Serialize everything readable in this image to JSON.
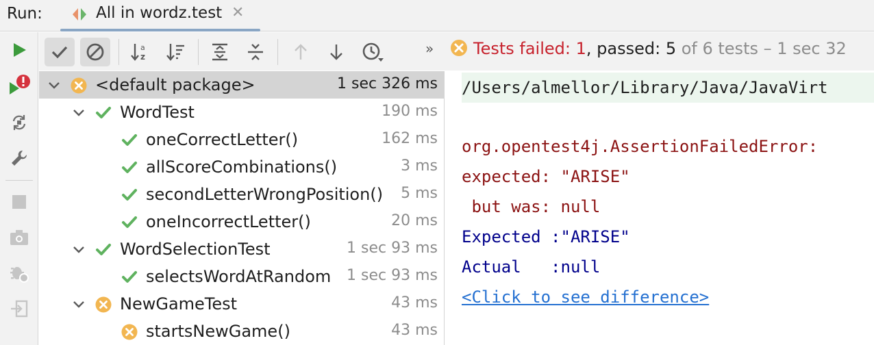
{
  "header": {
    "run_label": "Run:",
    "tab": {
      "title": "All in wordz.test",
      "close": "✕",
      "icon": "test-run-icon"
    }
  },
  "left_toolbar": [
    {
      "name": "rerun-icon"
    },
    {
      "name": "rerun-failed-icon"
    },
    {
      "name": "toggle-auto-test-icon"
    },
    {
      "name": "wrench-icon"
    },
    {
      "name": "stop-icon"
    },
    {
      "name": "camera-icon"
    },
    {
      "name": "debug-settings-icon"
    },
    {
      "name": "export-icon"
    }
  ],
  "toolbar": {
    "buttons": [
      "show-passed-icon",
      "show-ignored-icon",
      "sort-alphabetically-icon",
      "sort-by-duration-icon",
      "expand-all-icon",
      "collapse-all-icon",
      "previous-failed-icon",
      "next-failed-icon",
      "test-history-icon"
    ],
    "more": "»",
    "status": {
      "failed_label": "Tests failed: ",
      "failed_count": "1",
      "passed_part": ", passed: 5",
      "rest": " of 6 tests – 1 sec 32"
    }
  },
  "tree": {
    "rows": [
      {
        "label": "<default package>",
        "time": "1 sec 326 ms",
        "status": "failed",
        "level": 0,
        "expandable": true,
        "selected": true
      },
      {
        "label": "WordTest",
        "time": "190 ms",
        "status": "passed",
        "level": 1,
        "expandable": true
      },
      {
        "label": "oneCorrectLetter()",
        "time": "162 ms",
        "status": "passed",
        "level": 2
      },
      {
        "label": "allScoreCombinations()",
        "time": "3 ms",
        "status": "passed",
        "level": 2
      },
      {
        "label": "secondLetterWrongPosition()",
        "time": "5 ms",
        "status": "passed",
        "level": 2
      },
      {
        "label": "oneIncorrectLetter()",
        "time": "20 ms",
        "status": "passed",
        "level": 2
      },
      {
        "label": "WordSelectionTest",
        "time": "1 sec 93 ms",
        "status": "passed",
        "level": 1,
        "expandable": true
      },
      {
        "label": "selectsWordAtRandom",
        "time": "1 sec 93 ms",
        "status": "passed",
        "level": 2
      },
      {
        "label": "NewGameTest",
        "time": "43 ms",
        "status": "failed",
        "level": 1,
        "expandable": true
      },
      {
        "label": "startsNewGame()",
        "time": "43 ms",
        "status": "failed",
        "level": 2
      }
    ]
  },
  "console": {
    "command": "/Users/almellor/Library/Java/JavaVirt",
    "lines": [
      "org.opentest4j.AssertionFailedError:",
      "expected: \"ARISE\"",
      " but was: null",
      "Expected :\"ARISE\"",
      "Actual   :null"
    ],
    "diff_link": "<Click to see difference>"
  },
  "colors": {
    "passed": "#5fb25f",
    "failed_icon": "#f2b651",
    "failed_text": "#c7222d",
    "error_text": "#8b1212",
    "expected_text": "#00008b",
    "link": "#2470d1",
    "run_green": "#3c9b3c"
  }
}
